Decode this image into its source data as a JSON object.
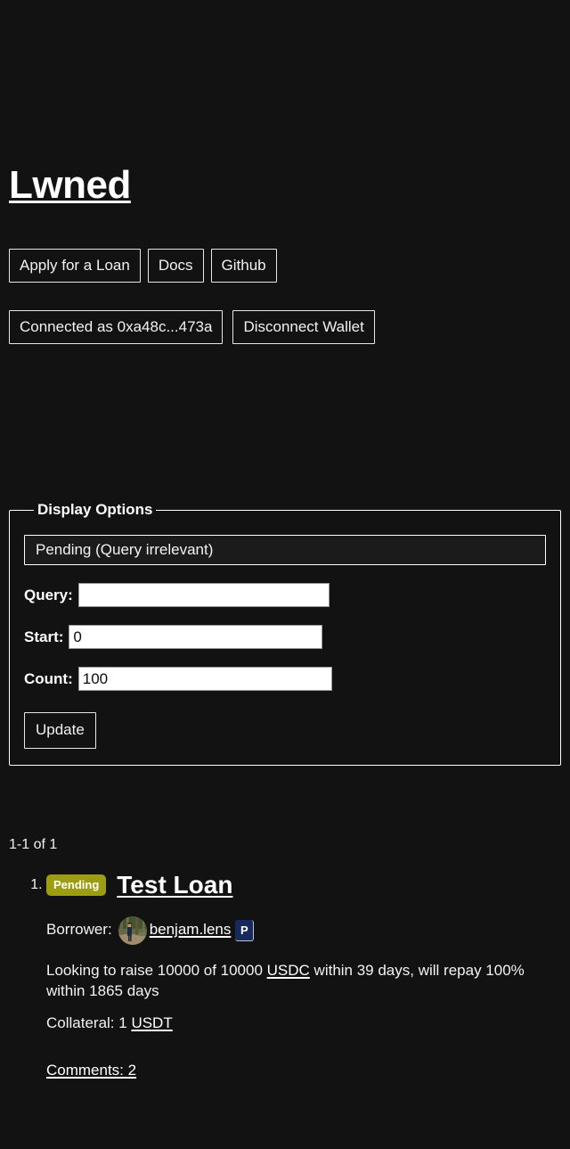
{
  "page": {
    "background_color": "#121212",
    "text_color": "#ffffff",
    "site_title": "Lwned"
  },
  "nav": {
    "items": [
      {
        "label": "Apply for a Loan",
        "name": "apply-for-a-loan-button"
      },
      {
        "label": "Docs",
        "name": "docs-button"
      },
      {
        "label": "Github",
        "name": "github-button"
      }
    ]
  },
  "wallet": {
    "connected_label": "Connected as 0xa48c...473a",
    "disconnect_label": "Disconnect Wallet"
  },
  "display_options": {
    "legend": "Display Options",
    "status_select": {
      "selected": "Pending (Query irrelevant)",
      "options": [
        "Pending (Query irrelevant)"
      ]
    },
    "query": {
      "label": "Query:",
      "value": "",
      "placeholder": ""
    },
    "start": {
      "label": "Start:",
      "value": "0"
    },
    "count": {
      "label": "Count:",
      "value": "100"
    },
    "update_label": "Update"
  },
  "results": {
    "count_text": "1-1 of 1",
    "loans": [
      {
        "status_badge": "Pending",
        "status_badge_color": "#9d9d11",
        "title": "Test Loan",
        "borrower_label": "Borrower:",
        "borrower_handle": "benjam.lens",
        "borrower_protocol_badge": "P",
        "borrower_protocol_badge_color": "#19295c",
        "description": "Looking to raise 10000 of 10000 USDC within 39 days, will repay 100% within 1865 days",
        "description_parts": {
          "before_token": "Looking to raise 10000 of 10000 ",
          "token": "USDC",
          "after_token": " within 39 days, will repay 100% within 1865 days"
        },
        "collateral_label": "Collateral: 1 ",
        "collateral_token": "USDT",
        "comments_text": "Comments: 2"
      }
    ]
  }
}
